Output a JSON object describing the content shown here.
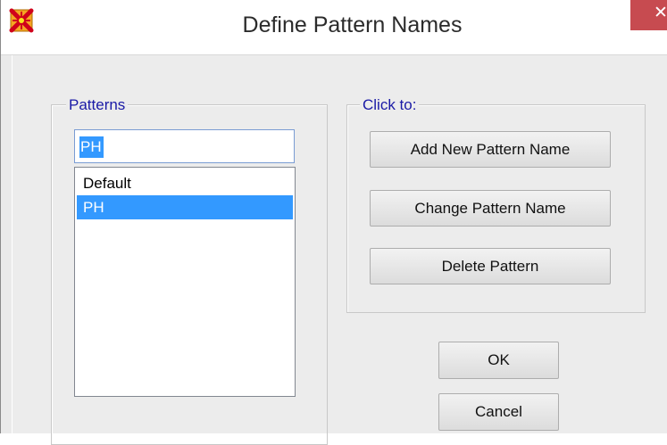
{
  "window": {
    "title": "Define Pattern Names",
    "icon": "sap-app-icon",
    "close_icon": "close-icon"
  },
  "patterns": {
    "group_label": "Patterns",
    "input_value": "PH",
    "items": [
      "Default",
      "PH"
    ],
    "selected_item": "PH"
  },
  "actions": {
    "group_label": "Click to:",
    "add_label": "Add New Pattern Name",
    "change_label": "Change Pattern Name",
    "delete_label": "Delete Pattern"
  },
  "dialog": {
    "ok_label": "OK",
    "cancel_label": "Cancel"
  },
  "colors": {
    "selection": "#3399ff",
    "group_label": "#1a1aa6",
    "close_button": "#c74b50"
  }
}
